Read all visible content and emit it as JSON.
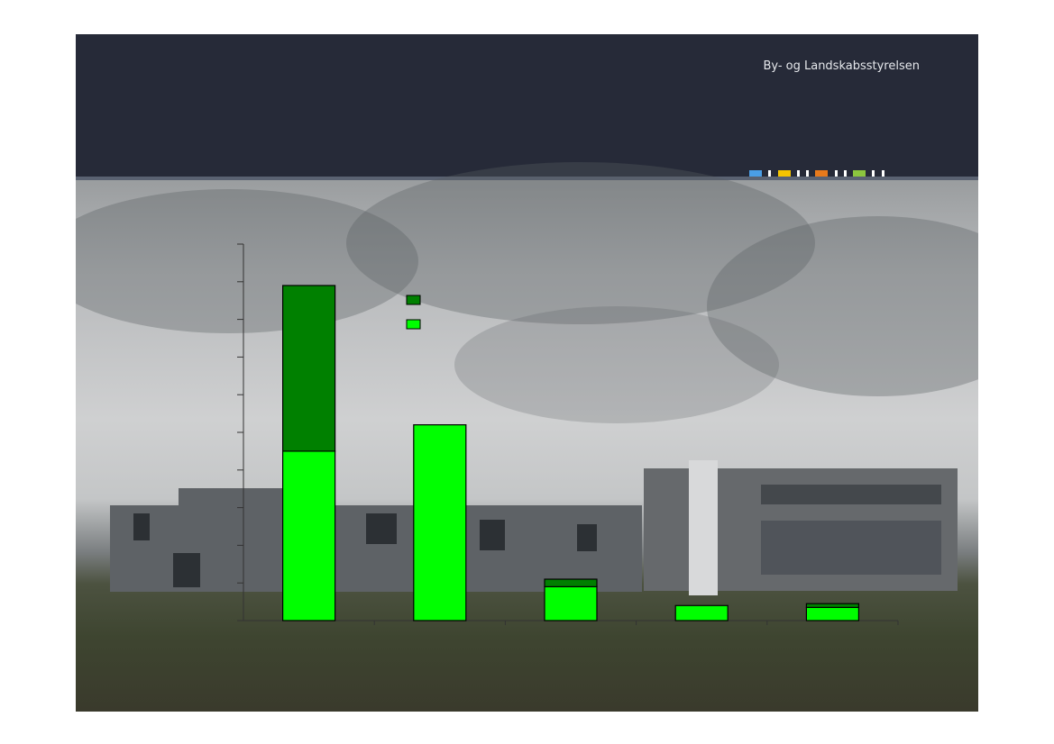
{
  "header": {
    "org_name": "By- og Landskabsstyrelsen",
    "logo_colors": [
      "#4a9ee6",
      "#ffffff",
      "#f5c400",
      "#ffffff",
      "#ffffff",
      "#e87a1c",
      "#ffffff",
      "#ffffff",
      "#8cc63e",
      "#ffffff",
      "#ffffff"
    ]
  },
  "photo": {
    "subject": "cloudy-sky-with-office-buildings"
  },
  "chart_data": {
    "type": "bar",
    "stacked": true,
    "categories": [
      "",
      "",
      "",
      "",
      ""
    ],
    "series": [
      {
        "color": "#00ff00",
        "values": [
          4.5,
          5.2,
          0.9,
          0.4,
          0.35
        ]
      },
      {
        "color": "#008000",
        "values": [
          4.4,
          0.0,
          0.2,
          0.0,
          0.1
        ]
      }
    ],
    "ylim": [
      0,
      10
    ],
    "y_ticks": [
      0,
      1,
      2,
      3,
      4,
      5,
      6,
      7,
      8,
      9,
      10
    ],
    "grid": false,
    "legend_position": "top-center",
    "title": "",
    "xlabel": "",
    "ylabel": ""
  }
}
